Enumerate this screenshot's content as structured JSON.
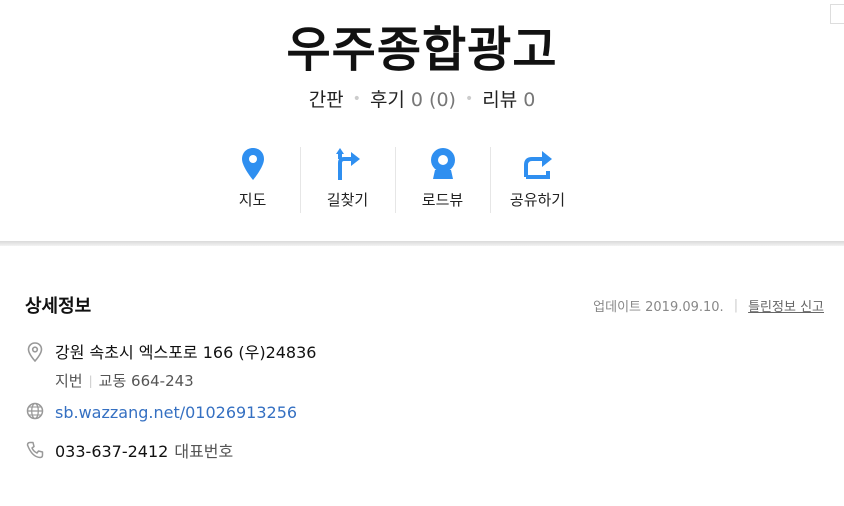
{
  "place": {
    "title": "우주종합광고"
  },
  "meta": {
    "category": "간판",
    "reviews_label": "후기",
    "reviews_count": "0 (0)",
    "review_label": "리뷰",
    "review_count": "0"
  },
  "actions": [
    {
      "label": "지도",
      "icon": "map-pin-icon"
    },
    {
      "label": "길찾기",
      "icon": "directions-arrow-icon"
    },
    {
      "label": "로드뷰",
      "icon": "roadview-camera-icon"
    },
    {
      "label": "공유하기",
      "icon": "share-arrow-icon"
    }
  ],
  "detail": {
    "title": "상세정보",
    "updated": "업데이트 2019.09.10.",
    "report_label": "틀린정보 신고",
    "address": "강원 속초시 엑스포로 166 (우)24836",
    "jibun_label": "지번",
    "jibun_value": "교동 664-243",
    "url": "sb.wazzang.net/01026913256",
    "phone": "033-637-2412",
    "phone_label": "대표번호"
  },
  "colors": {
    "accent_blue": "#2f8ff0",
    "link_blue": "#3570c2"
  }
}
